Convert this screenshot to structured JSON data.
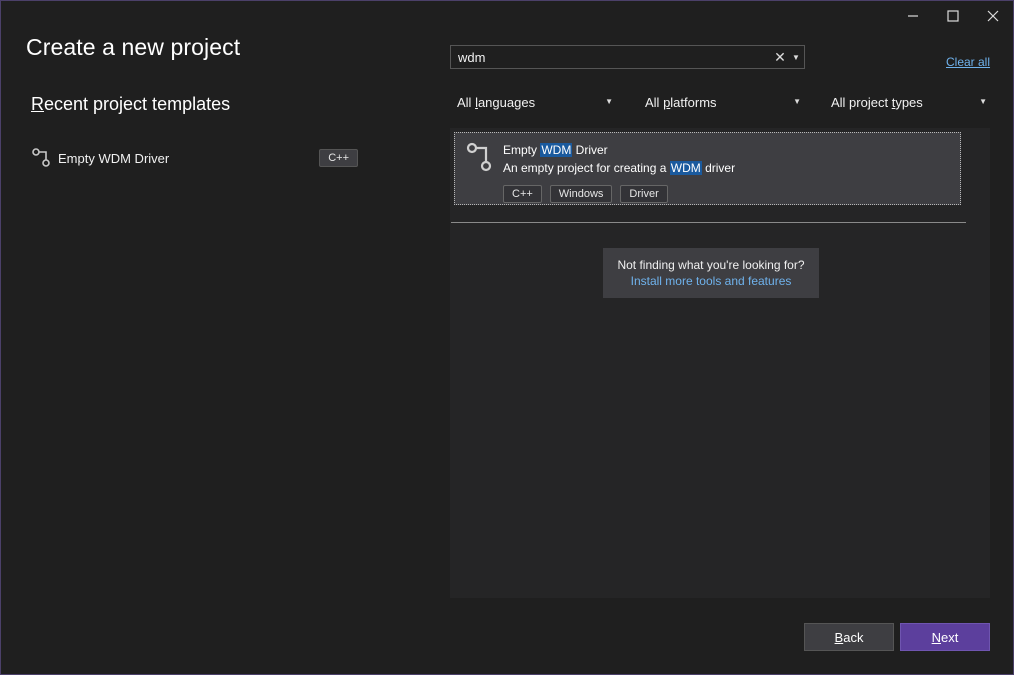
{
  "window": {
    "controls": [
      "minimize",
      "maximize",
      "close"
    ]
  },
  "header": {
    "title": "Create a new project"
  },
  "recent": {
    "title_first_letter": "R",
    "title_rest": "ecent project templates",
    "items": [
      {
        "label": "Empty WDM Driver",
        "language": "C++",
        "icon": "driver-template-icon"
      }
    ]
  },
  "search": {
    "value": "wdm",
    "clear_glyph": "✕",
    "dropdown_glyph": "▼",
    "clear_all_label": "Clear all"
  },
  "filters": {
    "languages": {
      "pre": "All ",
      "accel": "l",
      "post": "anguages"
    },
    "platforms": {
      "pre": "All ",
      "accel": "p",
      "post": "latforms"
    },
    "types": {
      "pre": "All project ",
      "accel": "t",
      "post": "ypes"
    },
    "arrow_glyph": "▼"
  },
  "results": {
    "cards": [
      {
        "name_pre": "Empty ",
        "name_highlight": "WDM",
        "name_post": " Driver",
        "desc_pre": "An empty project for creating a ",
        "desc_highlight": "WDM",
        "desc_post": " driver",
        "tags": [
          "C++",
          "Windows",
          "Driver"
        ],
        "icon": "driver-template-icon"
      }
    ],
    "not_found": {
      "question": "Not finding what you're looking for?",
      "link": "Install more tools and features"
    }
  },
  "footer": {
    "back": {
      "accel": "B",
      "rest": "ack"
    },
    "next": {
      "accel": "N",
      "rest": "ext"
    }
  },
  "colors": {
    "background": "#1f1f1f",
    "panel": "#252526",
    "card": "#3e3e42",
    "accent_button": "#5c3f9d",
    "link": "#6fb2ec",
    "highlight": "#1a5a9e"
  }
}
